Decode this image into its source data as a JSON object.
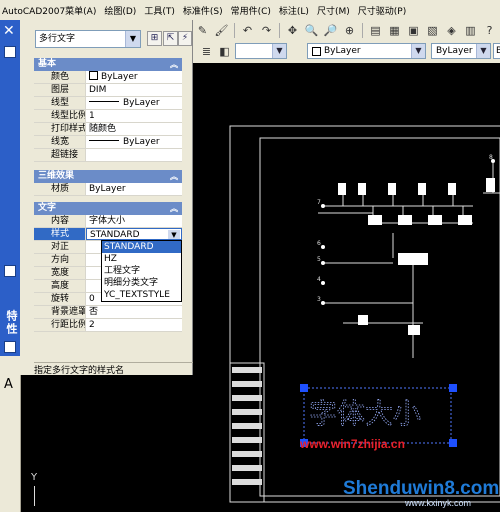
{
  "menu": [
    "AutoCAD2007菜单(A)",
    "绘图(D)",
    "工具(T)",
    "标准件(S)",
    "常用件(C)",
    "标注(L)",
    "尺寸(M)",
    "尺寸驱动(P)"
  ],
  "toolbar": {
    "layer_combo": "ByLayer",
    "color_combo": "ByLayer",
    "partial_combo": "By"
  },
  "palette": {
    "title": "特性",
    "object_type": "多行文字",
    "sections": {
      "basic": "基本",
      "three_d": "三维效果",
      "text": "文字"
    },
    "basic_rows": [
      {
        "label": "颜色",
        "value": "ByLayer"
      },
      {
        "label": "图层",
        "value": "DIM"
      },
      {
        "label": "线型",
        "value": "ByLayer"
      },
      {
        "label": "线型比例",
        "value": "1"
      },
      {
        "label": "打印样式",
        "value": "随颜色"
      },
      {
        "label": "线宽",
        "value": "ByLayer"
      },
      {
        "label": "超链接",
        "value": ""
      }
    ],
    "three_d_rows": [
      {
        "label": "材质",
        "value": "ByLayer"
      }
    ],
    "text_rows": [
      {
        "label": "内容",
        "value": "字体大小"
      },
      {
        "label": "样式",
        "value": "STANDARD"
      },
      {
        "label": "对正",
        "value": ""
      },
      {
        "label": "方向",
        "value": ""
      },
      {
        "label": "宽度",
        "value": ""
      },
      {
        "label": "高度",
        "value": ""
      },
      {
        "label": "旋转",
        "value": "0"
      },
      {
        "label": "背景遮罩",
        "value": "否"
      },
      {
        "label": "行距比例",
        "value": "2"
      }
    ],
    "style_options": [
      "STANDARD",
      "HZ",
      "工程文字",
      "明细分类文字",
      "YC_TEXTSTYLE"
    ],
    "description": "指定多行文字的样式名"
  },
  "left_strip": {
    "letter": "A"
  },
  "drawing": {
    "text": "字体大小",
    "leader_numbers": [
      "8",
      "7",
      "6",
      "5",
      "4",
      "3"
    ],
    "ucs_y": "Y"
  },
  "watermarks": {
    "site1": "www.win7zhijia.cn",
    "site2": "Shenduwin8.com",
    "site3": "www.kxinyk.com"
  },
  "colors": {
    "menu_bg": "#ece9d8",
    "title_blue": "#2c5fc8",
    "section_blue": "#6b8cc8",
    "selection": "#316ac5",
    "canvas": "#000000"
  }
}
